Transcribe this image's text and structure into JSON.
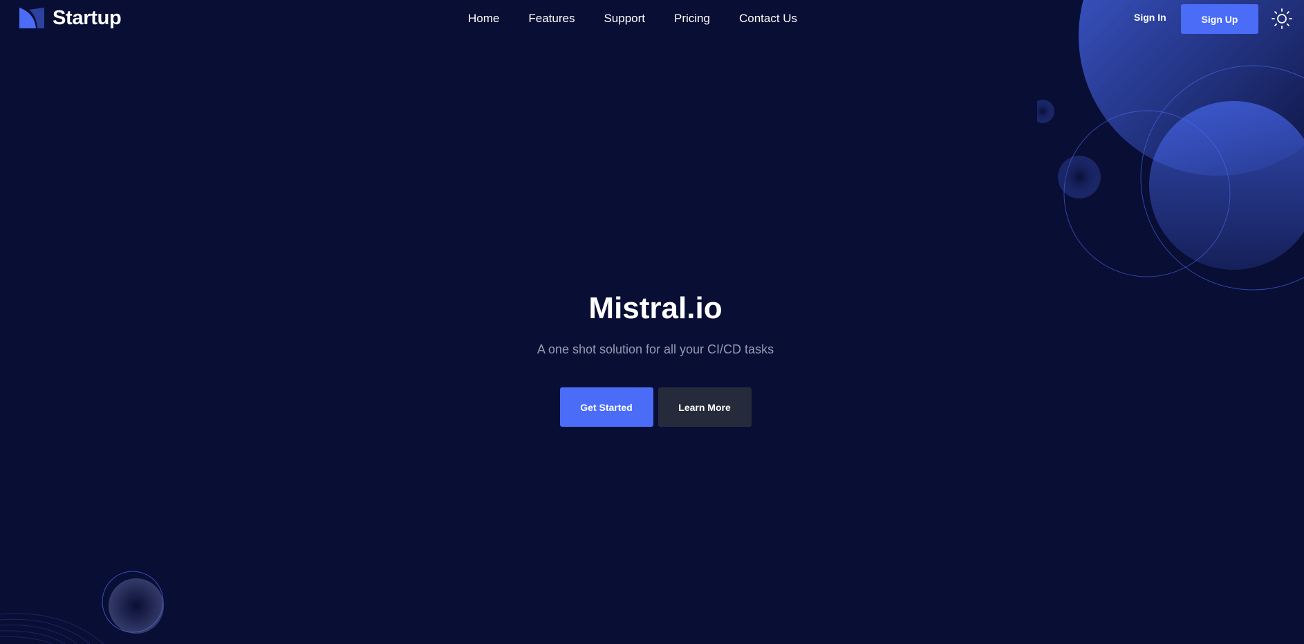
{
  "brand": {
    "name": "Startup",
    "logo_icon": "startup-logo-icon"
  },
  "nav": {
    "items": [
      {
        "label": "Home"
      },
      {
        "label": "Features"
      },
      {
        "label": "Support"
      },
      {
        "label": "Pricing"
      },
      {
        "label": "Contact Us"
      }
    ]
  },
  "auth": {
    "sign_in_label": "Sign In",
    "sign_up_label": "Sign Up"
  },
  "theme_toggle": {
    "icon": "sun-icon"
  },
  "hero": {
    "title": "Mistral.io",
    "subtitle": "A one shot solution for all your CI/CD tasks",
    "primary_button": "Get Started",
    "secondary_button": "Learn More"
  },
  "colors": {
    "background": "#090e34",
    "accent": "#4a6cf7",
    "secondary_button": "#262b3c",
    "subtitle_text": "#959cb1"
  }
}
